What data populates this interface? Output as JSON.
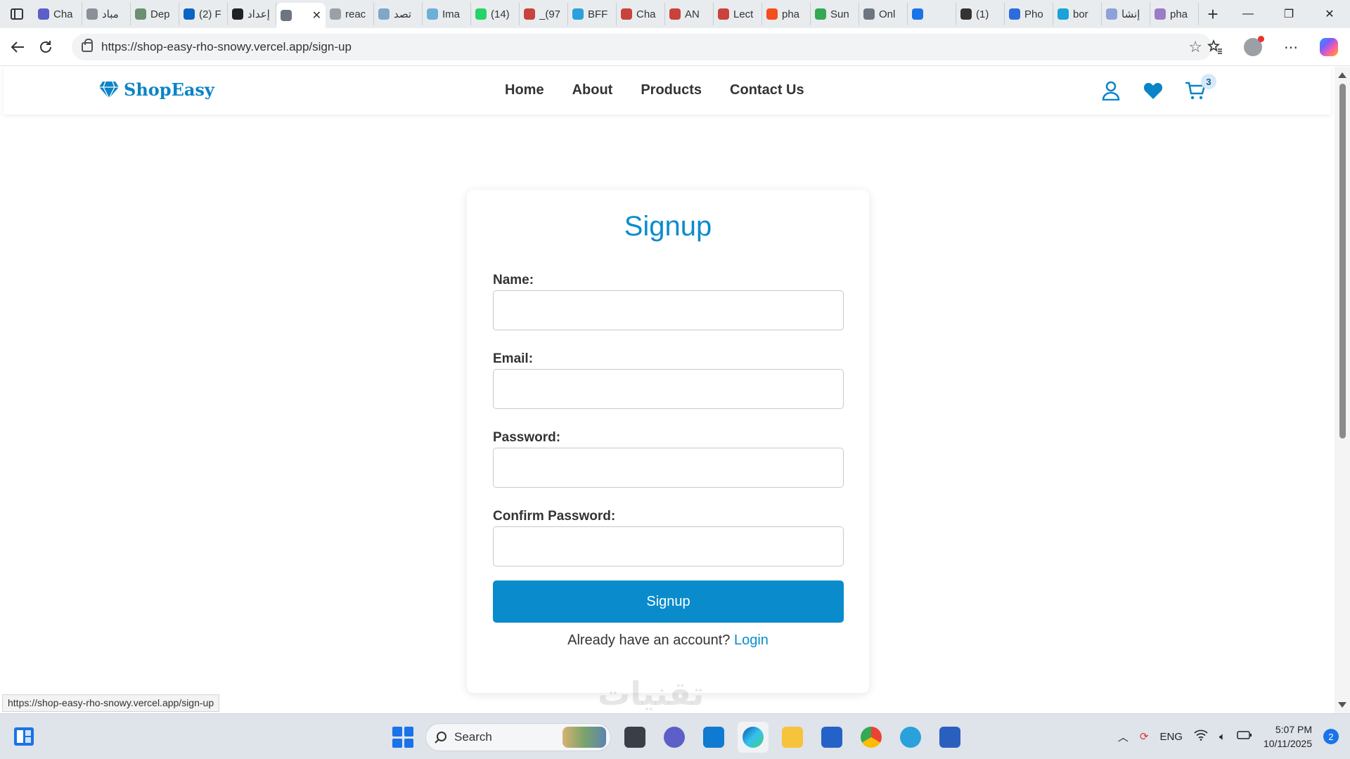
{
  "browser": {
    "tabs": [
      {
        "label": "Cha",
        "icon": "teams-icon",
        "color": "#5b5fc7"
      },
      {
        "label": "مباد",
        "icon": "person-icon",
        "color": "#8a8f98"
      },
      {
        "label": "Dep",
        "icon": "person-icon",
        "color": "#6b8f71"
      },
      {
        "label": "(2) F",
        "icon": "linkedin-icon",
        "color": "#0a66c2"
      },
      {
        "label": "إعداد",
        "icon": "chatgpt-icon",
        "color": "#202123"
      },
      {
        "label": "",
        "icon": "cart-favicon",
        "color": "#6d7580",
        "active": true
      },
      {
        "label": "reac",
        "icon": "search-icon",
        "color": "#9aa0a6"
      },
      {
        "label": "تصد",
        "icon": "circle-icon",
        "color": "#7fa7c9"
      },
      {
        "label": "Ima",
        "icon": "image-icon",
        "color": "#6cb0d8"
      },
      {
        "label": "(14)",
        "icon": "whatsapp-icon",
        "color": "#25d366"
      },
      {
        "label": "_(97",
        "icon": "pdf-icon",
        "color": "#c9423c"
      },
      {
        "label": "BFF",
        "icon": "telegram-icon",
        "color": "#2aa1da"
      },
      {
        "label": "Cha",
        "icon": "pdf-icon",
        "color": "#c9423c"
      },
      {
        "label": "AN",
        "icon": "pdf-icon",
        "color": "#c9423c"
      },
      {
        "label": "Lect",
        "icon": "pdf-icon",
        "color": "#c9423c"
      },
      {
        "label": "pha",
        "icon": "figma-icon",
        "color": "#f24e1e"
      },
      {
        "label": "Sun",
        "icon": "sheets-icon",
        "color": "#34a853"
      },
      {
        "label": "Onl",
        "icon": "ring-icon",
        "color": "#6d7580"
      },
      {
        "label": "",
        "icon": "spinner-icon",
        "color": "#1a73e8"
      },
      {
        "label": "(1)",
        "icon": "bracket-icon",
        "color": "#333333"
      },
      {
        "label": "Pho",
        "icon": "flag-icon",
        "color": "#2d6cdf"
      },
      {
        "label": "bor",
        "icon": "wave-icon",
        "color": "#1aa3d8"
      },
      {
        "label": "إنشا",
        "icon": "cloud-icon",
        "color": "#8ea2d8"
      },
      {
        "label": "pha",
        "icon": "v-icon",
        "color": "#9b7cc7"
      }
    ],
    "url": "https://shop-easy-rho-snowy.vercel.app/sign-up",
    "status_url": "https://shop-easy-rho-snowy.vercel.app/sign-up",
    "new_tab": "+",
    "close_tab": "✕",
    "window": {
      "minimize": "—",
      "restore": "❐",
      "close": "✕"
    }
  },
  "site": {
    "brand": "ShopEasy",
    "brand_color": "#0a84c6",
    "nav": [
      "Home",
      "About",
      "Products",
      "Contact Us"
    ],
    "cart_count": "3"
  },
  "form": {
    "title": "Signup",
    "fields": [
      {
        "label": "Name:",
        "value": "",
        "type": "text"
      },
      {
        "label": "Email:",
        "value": "",
        "type": "email"
      },
      {
        "label": "Password:",
        "value": "",
        "type": "password"
      },
      {
        "label": "Confirm Password:",
        "value": "",
        "type": "password"
      }
    ],
    "submit_label": "Signup",
    "already_text": "Already have an account?",
    "login_link": "Login",
    "accent": "#0a8ccc"
  },
  "watermark": "تقنيات",
  "taskbar": {
    "search_placeholder": "Search",
    "apps": [
      "file-explorer-icon",
      "copilot-app-icon",
      "vscode-icon",
      "edge-icon",
      "folder-icon",
      "store-icon",
      "chrome-icon",
      "telegram-icon",
      "word-icon"
    ],
    "language": "ENG",
    "time": "5:07 PM",
    "date": "10/11/2025",
    "notifications": "2"
  }
}
